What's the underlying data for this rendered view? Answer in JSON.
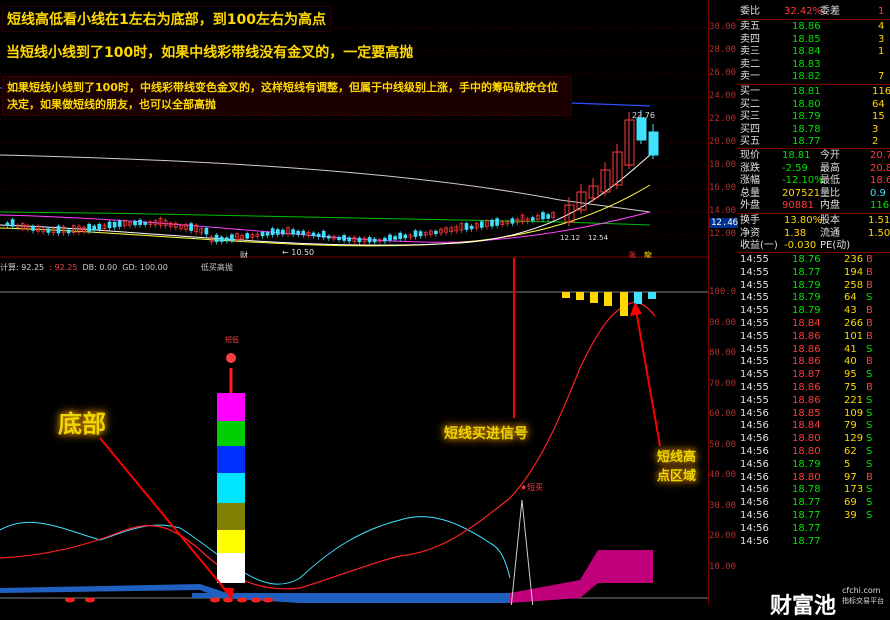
{
  "notes": {
    "line1": "短线高低看小线在1左右为底部，到100左右为高点",
    "line2": "当短线小线到了100时，如果中线彩带线没有金叉的，一定要高抛",
    "line3": "如果短线小线到了100时，中线彩带线变色金叉的，这样短线有调整，但属于中线级别上涨，手中的筹码就按仓位决定，如果做短线的朋友，也可以全部高抛"
  },
  "callouts": {
    "bottom": "底部",
    "buy": "短线买进信号",
    "high": "短线高点区域"
  },
  "price_axis": [
    "30.00",
    "28.00",
    "26.00",
    "24.00",
    "22.00",
    "20.00",
    "18.00",
    "16.00",
    "14.00",
    "12.00"
  ],
  "current_price_tag": "12.46",
  "ind_axis": [
    "100.0",
    "90.00",
    "80.00",
    "70.00",
    "60.00",
    "50.00",
    "40.00",
    "30.00",
    "20.00",
    "10.00"
  ],
  "price_labels": {
    "high": "22.76",
    "low": "10.50",
    "mid1": "12.12",
    "mid2": "12.54",
    "cai": "财",
    "zhang": "涨",
    "long": "龍"
  },
  "ind_header": {
    "a": "计算: 92.25",
    "b": ": 92.25",
    "c": "DB: 0.00",
    "d": "GD: 100.00",
    "e": "低买高抛"
  },
  "ind_labels": {
    "short_low": "短低",
    "short_buy": "★短买"
  },
  "colors": {
    "up": "#ff3b3b",
    "down": "#00e000",
    "yellow": "#ffd800",
    "cyan": "#40e0ff"
  },
  "quote": {
    "weibi": [
      "委比",
      "32.42%",
      "委差",
      "1"
    ],
    "asks": [
      [
        "卖五",
        "18.86",
        "4"
      ],
      [
        "卖四",
        "18.85",
        "3"
      ],
      [
        "卖三",
        "18.84",
        "1"
      ],
      [
        "卖二",
        "18.83",
        ""
      ],
      [
        "卖一",
        "18.82",
        "7"
      ]
    ],
    "bids": [
      [
        "买一",
        "18.81",
        "116"
      ],
      [
        "买二",
        "18.80",
        "64"
      ],
      [
        "买三",
        "18.79",
        "15"
      ],
      [
        "买四",
        "18.78",
        "3"
      ],
      [
        "买五",
        "18.77",
        "2"
      ]
    ],
    "stats": [
      [
        "现价",
        "18.81",
        "今开",
        "20.7"
      ],
      [
        "涨跌",
        "-2.59",
        "最高",
        "20.8"
      ],
      [
        "涨幅",
        "-12.10%",
        "最低",
        "18.6"
      ],
      [
        "总量",
        "207521",
        "量比",
        "0.9"
      ],
      [
        "外盘",
        "90881",
        "内盘",
        "11664"
      ]
    ],
    "stats2": [
      [
        "换手",
        "13.80%",
        "股本",
        "1.51"
      ],
      [
        "净资",
        "1.38",
        "流通",
        "1.50"
      ],
      [
        "收益(一)",
        "-0.030",
        "PE(动)",
        ""
      ]
    ]
  },
  "ticks": [
    [
      "14:55",
      "18.76",
      "236",
      "B"
    ],
    [
      "14:55",
      "18.77",
      "194",
      "B"
    ],
    [
      "14:55",
      "18.79",
      "258",
      "B"
    ],
    [
      "14:55",
      "18.79",
      "64",
      "S"
    ],
    [
      "14:55",
      "18.79",
      "43",
      "B"
    ],
    [
      "14:55",
      "18.84",
      "266",
      "B"
    ],
    [
      "14:55",
      "18.86",
      "101",
      "B"
    ],
    [
      "14:55",
      "18.86",
      "41",
      "S"
    ],
    [
      "14:55",
      "18.86",
      "40",
      "B"
    ],
    [
      "14:55",
      "18.87",
      "95",
      "S"
    ],
    [
      "14:55",
      "18.86",
      "75",
      "B"
    ],
    [
      "14:55",
      "18.86",
      "221",
      "S"
    ],
    [
      "14:56",
      "18.85",
      "109",
      "S"
    ],
    [
      "14:56",
      "18.84",
      "79",
      "S"
    ],
    [
      "14:56",
      "18.80",
      "129",
      "S"
    ],
    [
      "14:56",
      "18.80",
      "62",
      "S"
    ],
    [
      "14:56",
      "18.79",
      "5",
      "S"
    ],
    [
      "14:56",
      "18.80",
      "97",
      "B"
    ],
    [
      "14:56",
      "18.78",
      "173",
      "S"
    ],
    [
      "14:56",
      "18.77",
      "69",
      "S"
    ],
    [
      "14:56",
      "18.77",
      "39",
      "S"
    ],
    [
      "14:56",
      "18.77",
      "",
      ""
    ],
    [
      "14:56",
      "18.77",
      "",
      ""
    ]
  ],
  "watermark": {
    "logo": "财富池",
    "site": "cfchi.com",
    "sub": "指标交易平台"
  }
}
